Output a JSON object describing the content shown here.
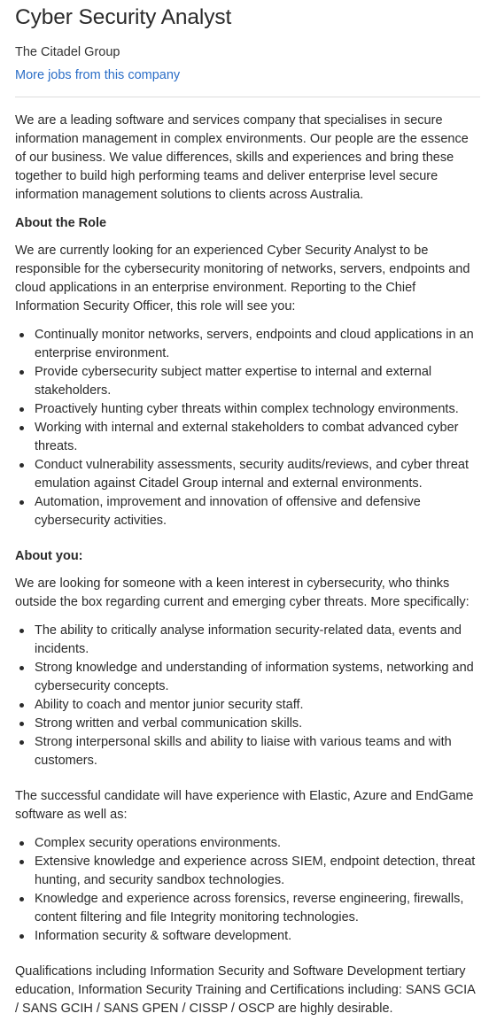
{
  "job": {
    "title": "Cyber Security Analyst",
    "company": "The Citadel Group",
    "more_jobs_link": "More jobs from this company"
  },
  "description": {
    "intro": "We are a leading software and services company that specialises in secure information management in complex environments. Our people are the essence of our business. We value differences, skills and experiences and bring these together to build high performing teams and deliver enterprise level secure information management solutions to clients across Australia.",
    "about_role": {
      "heading": "About the Role",
      "paragraph": "We are currently looking for an experienced Cyber Security Analyst to be responsible for the cybersecurity monitoring of networks, servers, endpoints and cloud applications in an enterprise environment.  Reporting to the Chief Information Security Officer, this role will see you:",
      "items": [
        "Continually monitor networks, servers, endpoints and cloud applications in an enterprise environment.",
        "Provide cybersecurity subject matter expertise to internal and external stakeholders.",
        "Proactively hunting cyber threats within complex technology environments.",
        "Working with internal and external stakeholders to combat advanced cyber threats.",
        "Conduct vulnerability assessments, security audits/reviews, and cyber threat emulation against Citadel Group internal and external environments.",
        "Automation, improvement and innovation of offensive and defensive cybersecurity activities."
      ]
    },
    "about_you": {
      "heading": "About you:",
      "paragraph": "We are looking for someone with a keen interest in cybersecurity, who thinks outside the box regarding current and emerging cyber threats.  More specifically:",
      "items": [
        "The ability to critically analyse information security-related data, events and incidents.",
        "Strong knowledge and understanding of information systems, networking and cybersecurity concepts.",
        "Ability to coach and mentor junior security staff.",
        "Strong written and verbal communication skills.",
        "Strong interpersonal skills and ability to liaise with various teams and with customers."
      ]
    },
    "experience": {
      "paragraph": "The successful candidate will have experience with Elastic, Azure and EndGame software as well as:",
      "items": [
        "Complex security operations environments.",
        "Extensive knowledge and experience across SIEM, endpoint detection, threat hunting, and security sandbox technologies.",
        "Knowledge and experience across forensics, reverse engineering, firewalls, content filtering and file Integrity monitoring technologies.",
        "Information security & software development."
      ]
    },
    "qualifications": "Qualifications including Information Security and Software Development tertiary education, Information Security Training and Certifications including: SANS GCIA / SANS GCIH / SANS GPEN / CISSP / OSCP are highly desirable."
  },
  "colors": {
    "text": "#2a2a2a",
    "link": "#2b6ec7",
    "divider": "#dddddd"
  }
}
